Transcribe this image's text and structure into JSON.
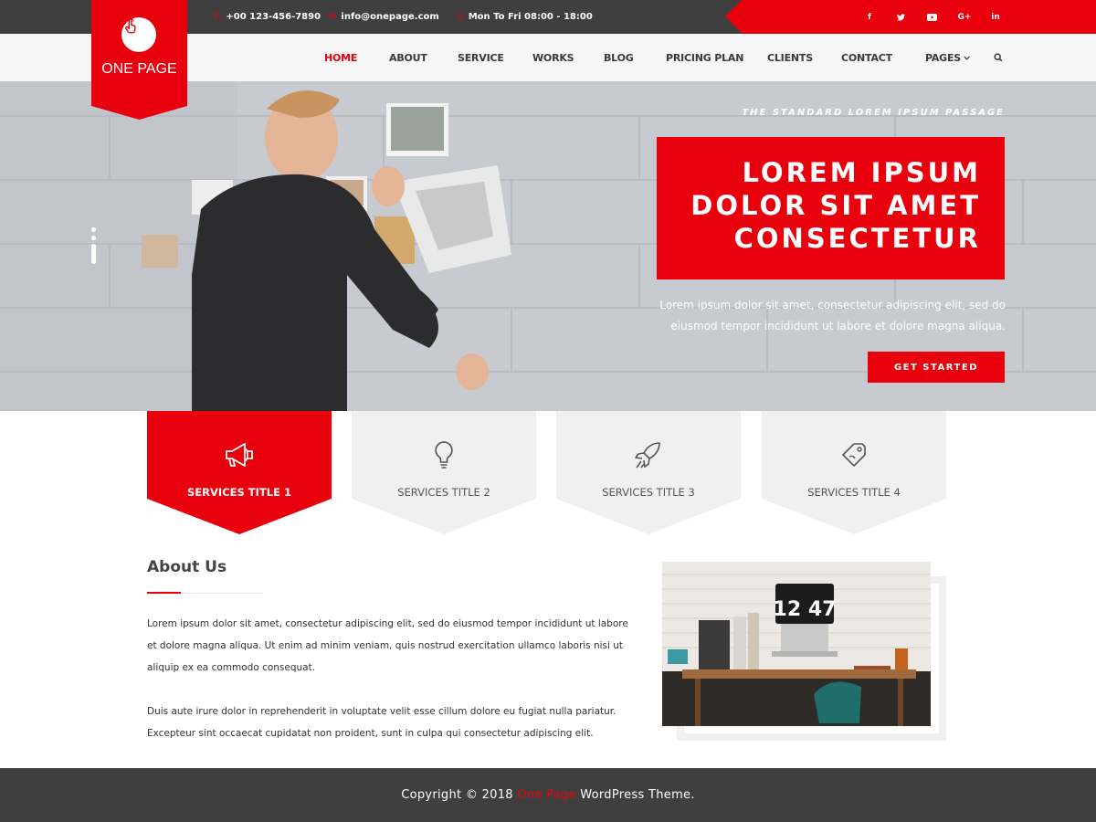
{
  "topbar": {
    "phone": "+00 123-456-7890",
    "email": "info@onepage.com",
    "hours": "Mon To Fri 08:00 - 18:00",
    "social": [
      "f",
      "t",
      "yt",
      "G+",
      "in"
    ]
  },
  "logo": {
    "name": "ONE PAGE",
    "icon": "hand-pointer-icon"
  },
  "nav": {
    "items": [
      {
        "label": "HOME",
        "active": true
      },
      {
        "label": "ABOUT"
      },
      {
        "label": "SERVICE"
      },
      {
        "label": "WORKS"
      },
      {
        "label": "BLOG"
      },
      {
        "label": "PRICING PLAN"
      },
      {
        "label": "CLIENTS"
      },
      {
        "label": "CONTACT"
      },
      {
        "label": "PAGES"
      }
    ],
    "search_icon": "search-icon"
  },
  "hero": {
    "subtitle": "THE STANDARD LOREM IPSUM PASSAGE",
    "title_lines": [
      "LOREM IPSUM",
      "DOLOR SIT AMET",
      "CONSECTETUR"
    ],
    "description": "Lorem ipsum dolor sit amet, consectetur adipiscing elit, sed do eiusmod tempor incididunt ut labore et dolore magna aliqua.",
    "button": "GET STARTED"
  },
  "services": [
    {
      "title": "SERVICES TITLE 1",
      "icon": "megaphone-icon",
      "active": true
    },
    {
      "title": "SERVICES TITLE 2",
      "icon": "lightbulb-icon"
    },
    {
      "title": "SERVICES TITLE 3",
      "icon": "rocket-icon"
    },
    {
      "title": "SERVICES TITLE 4",
      "icon": "tag-icon"
    }
  ],
  "about": {
    "title": "About Us",
    "paragraph1": "Lorem ipsum dolor sit amet, consectetur adipiscing elit, sed do eiusmod tempor incididunt ut labore et dolore magna aliqua. Ut enim ad minim veniam, quis nostrud exercitation ullamco laboris nisi ut aliquip ex ea commodo consequat.",
    "paragraph2": "Duis aute irure dolor in reprehenderit in voluptate velit esse cillum dolore eu fugiat nulla pariatur. Excepteur sint occaecat cupidatat non proident, sunt in culpa qui consectetur adipiscing elit.",
    "image_clock": "12 47"
  },
  "footer": {
    "prefix": "Copyright © 2018",
    "brand": "One Page",
    "suffix": "WordPress Theme."
  },
  "colors": {
    "accent": "#e8000c",
    "dark": "#3f3f3f",
    "light": "#f0f0f0"
  }
}
